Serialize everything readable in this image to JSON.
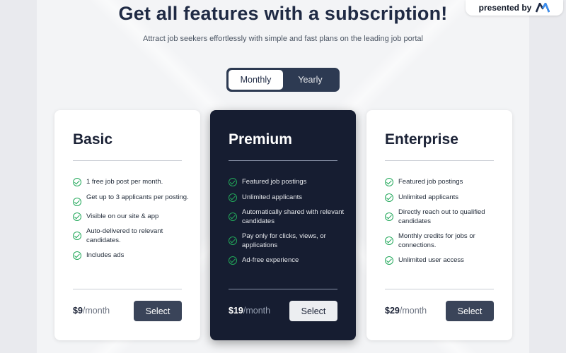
{
  "presented": {
    "label": "presented by"
  },
  "header": {
    "title": "Get all features with a subscription!",
    "subtitle": "Attract job seekers effortlessly with simple and fast plans on the leading job portal"
  },
  "billing_toggle": {
    "options": [
      "Monthly",
      "Yearly"
    ],
    "selected": "Monthly"
  },
  "plans": [
    {
      "name": "Basic",
      "features": [
        "1 free job post per month.",
        "Get up to 3 applicants per posting.",
        "Visible on our site & app",
        "Auto-delivered to relevant candidates.",
        "Includes ads"
      ],
      "price": "$9",
      "period": "/month",
      "button": "Select"
    },
    {
      "name": "Premium",
      "features": [
        "Featured job postings",
        "Unlimited applicants",
        "Automatically shared with relevant candidates",
        "Pay only for clicks, views, or applications",
        "Ad-free experience"
      ],
      "price": "$19",
      "period": "/month",
      "button": "Select"
    },
    {
      "name": "Enterprise",
      "features": [
        "Featured job postings",
        "Unlimited applicants",
        "Directly reach out to qualified candidates",
        "Monthly credits for jobs or connections.",
        "Unlimited user access"
      ],
      "price": "$29",
      "period": "/month",
      "button": "Select"
    }
  ],
  "colors": {
    "accent_dark": "#161d31",
    "check_green": "#22a85a",
    "button_dark": "#3a4459",
    "title_color": "#1f2a44"
  },
  "icons": {
    "feature": "check-circle-icon",
    "logo": "brand-logo-icon"
  }
}
